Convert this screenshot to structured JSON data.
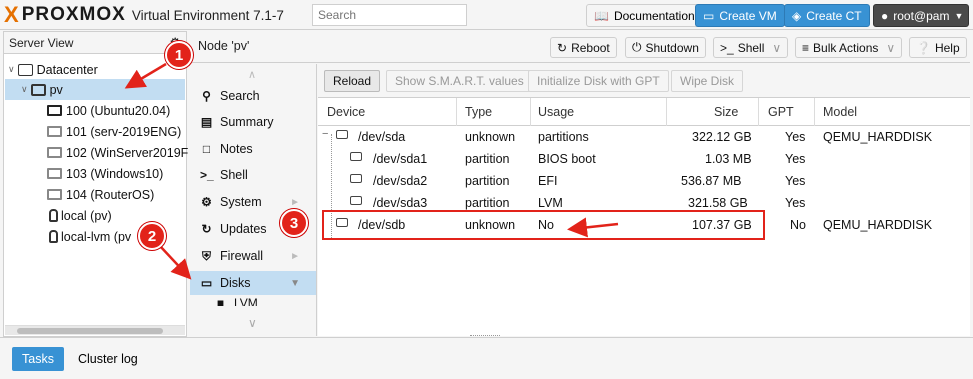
{
  "header": {
    "logo_text": "PROXMOX",
    "logo_x": "X",
    "version": "Virtual Environment 7.1-7",
    "search_placeholder": "Search",
    "documentation": "Documentation",
    "create_vm": "Create VM",
    "create_ct": "Create CT",
    "user": "root@pam"
  },
  "tree": {
    "view": "Server View",
    "datacenter": "Datacenter",
    "node": "pv",
    "items": [
      {
        "label": "100 (Ubuntu20.04)",
        "running": true
      },
      {
        "label": "101 (serv-2019ENG)",
        "running": false
      },
      {
        "label": "102 (WinServer2019F",
        "running": false
      },
      {
        "label": "103 (Windows10)",
        "running": false
      },
      {
        "label": "104 (RouterOS)",
        "running": false
      }
    ],
    "storage": [
      "local (pv)",
      "local-lvm (pv"
    ]
  },
  "node_panel": {
    "title": "Node 'pv'",
    "reboot": "Reboot",
    "shutdown": "Shutdown",
    "shell": "Shell",
    "bulk": "Bulk Actions",
    "help": "Help"
  },
  "nav": [
    {
      "label": "Search",
      "icon": "search-icon"
    },
    {
      "label": "Summary",
      "icon": "book-icon"
    },
    {
      "label": "Notes",
      "icon": "notes-icon"
    },
    {
      "label": "Shell",
      "icon": "terminal-icon"
    },
    {
      "label": "System",
      "icon": "gears-icon"
    },
    {
      "label": "Updates",
      "icon": "refresh-icon"
    },
    {
      "label": "Firewall",
      "icon": "shield-icon"
    },
    {
      "label": "Disks",
      "icon": "hdd-icon"
    },
    {
      "label": "LVM",
      "icon": "square-icon"
    }
  ],
  "grid": {
    "toolbar": {
      "reload": "Reload",
      "smart": "Show S.M.A.R.T. values",
      "init": "Initialize Disk with GPT",
      "wipe": "Wipe Disk"
    },
    "columns": [
      "Device",
      "Type",
      "Usage",
      "Size",
      "GPT",
      "Model"
    ],
    "rows": [
      {
        "device": "/dev/sda",
        "type": "unknown",
        "usage": "partitions",
        "size": "322.12 GB",
        "gpt": "Yes",
        "model": "QEMU_HARDDISK"
      },
      {
        "device": "/dev/sda1",
        "type": "partition",
        "usage": "BIOS boot",
        "size": "1.03 MB",
        "gpt": "Yes",
        "model": ""
      },
      {
        "device": "/dev/sda2",
        "type": "partition",
        "usage": "EFI",
        "size": "536.87 MB",
        "gpt": "Yes",
        "model": ""
      },
      {
        "device": "/dev/sda3",
        "type": "partition",
        "usage": "LVM",
        "size": "321.58 GB",
        "gpt": "Yes",
        "model": ""
      },
      {
        "device": "/dev/sdb",
        "type": "unknown",
        "usage": "No",
        "size": "107.37 GB",
        "gpt": "No",
        "model": "QEMU_HARDDISK"
      }
    ]
  },
  "bottom": {
    "tasks": "Tasks",
    "cluster_log": "Cluster log"
  },
  "annotations": {
    "badge1": "1",
    "badge2": "2",
    "badge3": "3",
    "color": "#e2231a"
  }
}
